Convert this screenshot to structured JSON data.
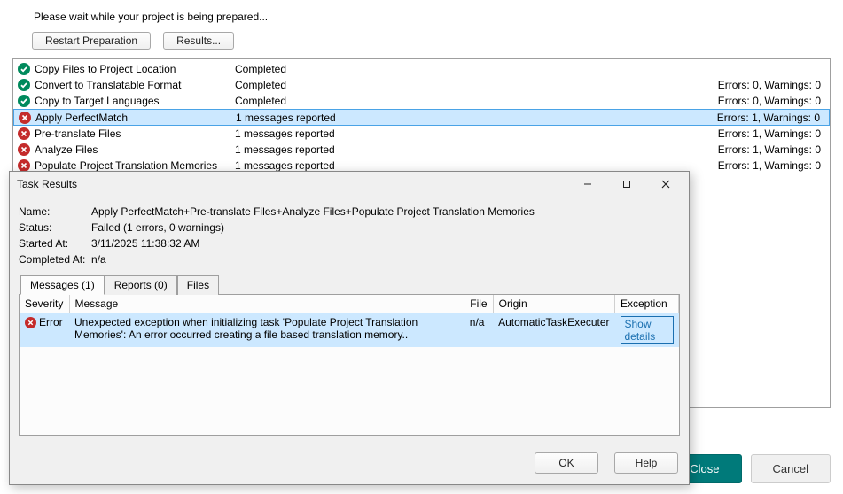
{
  "header": {
    "wait_message": "Please wait while your project is being prepared..."
  },
  "buttons": {
    "restart": "Restart Preparation",
    "results": "Results..."
  },
  "tasks": [
    {
      "name": "Copy Files to Project Location",
      "status": "Completed",
      "stats": "",
      "ok": true,
      "selected": false
    },
    {
      "name": "Convert to Translatable Format",
      "status": "Completed",
      "stats": "Errors: 0, Warnings: 0",
      "ok": true,
      "selected": false
    },
    {
      "name": "Copy to Target Languages",
      "status": "Completed",
      "stats": "Errors: 0, Warnings: 0",
      "ok": true,
      "selected": false
    },
    {
      "name": "Apply PerfectMatch",
      "status": "1 messages reported",
      "stats": "Errors: 1, Warnings: 0",
      "ok": false,
      "selected": true
    },
    {
      "name": "Pre-translate Files",
      "status": "1 messages reported",
      "stats": "Errors: 1, Warnings: 0",
      "ok": false,
      "selected": false
    },
    {
      "name": "Analyze Files",
      "status": "1 messages reported",
      "stats": "Errors: 1, Warnings: 0",
      "ok": false,
      "selected": false
    },
    {
      "name": "Populate Project Translation Memories",
      "status": "1 messages reported",
      "stats": "Errors: 1, Warnings: 0",
      "ok": false,
      "selected": false
    }
  ],
  "footer": {
    "close": "Close",
    "cancel": "Cancel"
  },
  "dialog": {
    "title": "Task Results",
    "kv": {
      "name_label": "Name:",
      "name_value": "Apply PerfectMatch+Pre-translate Files+Analyze Files+Populate Project Translation Memories",
      "status_label": "Status:",
      "status_value": "Failed (1 errors, 0 warnings)",
      "started_label": "Started At:",
      "started_value": "3/11/2025 11:38:32 AM",
      "completed_label": "Completed At:",
      "completed_value": "n/a"
    },
    "tabs": {
      "messages": "Messages (1)",
      "reports": "Reports (0)",
      "files": "Files"
    },
    "columns": {
      "severity": "Severity",
      "message": "Message",
      "file": "File",
      "origin": "Origin",
      "exception": "Exception"
    },
    "row": {
      "severity": "Error",
      "message": "Unexpected exception when initializing task 'Populate Project Translation Memories': An error occurred creating a file based translation memory..",
      "file": "n/a",
      "origin": "AutomaticTaskExecuter",
      "exception": "Show details"
    },
    "buttons": {
      "ok": "OK",
      "help": "Help"
    }
  }
}
